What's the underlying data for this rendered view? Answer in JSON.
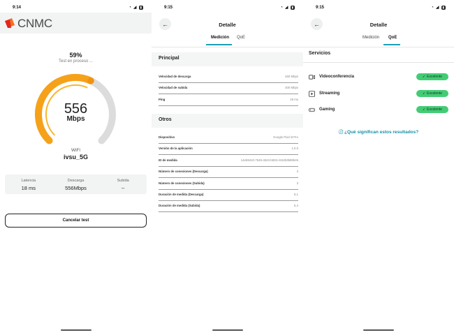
{
  "colors": {
    "accent": "#1a9fb5",
    "gauge_orange": "#f5a21a",
    "badge_green": "#43cc75"
  },
  "screen1": {
    "status": {
      "time": "9:14"
    },
    "brand": "CNMC",
    "progress": {
      "percent_text": "59%",
      "fraction": 0.59,
      "text": "Test en proceso ..."
    },
    "speed": {
      "value": "556",
      "unit": "Mbps"
    },
    "network": {
      "label": "WiFi",
      "name": "ivsu_5G"
    },
    "stats": [
      {
        "label": "Latencia",
        "value": "18 ms"
      },
      {
        "label": "Descarga",
        "value": "556Mbps"
      },
      {
        "label": "Subida",
        "value": "--"
      }
    ],
    "cancel_label": "Cancelar test"
  },
  "screen2": {
    "status": {
      "time": "9:15"
    },
    "title": "Detalle",
    "tabs": [
      "Medición",
      "QoE"
    ],
    "principal": {
      "title": "Principal",
      "rows": [
        {
          "label": "Velocidad de descarga",
          "value": "460 Mbps"
        },
        {
          "label": "Velocidad de subida",
          "value": "400 Mbps"
        },
        {
          "label": "Ping",
          "value": "18 ms"
        }
      ]
    },
    "otros": {
      "title": "Otros",
      "rows": [
        {
          "label": "Dispositivo",
          "value": "Google Pixel 8 Pro"
        },
        {
          "label": "Versión de la aplicación",
          "value": "1.0.0"
        },
        {
          "label": "ID de medida",
          "value": "14eb9410-7549-4543-b833-415253b89b45"
        },
        {
          "label": "Número de conexiones (Descarga)",
          "value": "3"
        },
        {
          "label": "Número de conexiones (Subida)",
          "value": "3"
        },
        {
          "label": "Duración de medida (Descarga)",
          "value": "6,1"
        },
        {
          "label": "Duración de medida (Subida)",
          "value": "6,4"
        }
      ]
    }
  },
  "screen3": {
    "status": {
      "time": "9:15"
    },
    "title": "Detalle",
    "tabs": [
      "Medición",
      "QoE"
    ],
    "services_title": "Servicios",
    "services": [
      {
        "name": "Videoconferencia",
        "icon": "video-icon",
        "rating": "Excelente"
      },
      {
        "name": "Streaming",
        "icon": "play-icon",
        "rating": "Excelente"
      },
      {
        "name": "Gaming",
        "icon": "gamepad-icon",
        "rating": "Excelente"
      }
    ],
    "help_link": "¿Qué significan estos resultados?"
  }
}
